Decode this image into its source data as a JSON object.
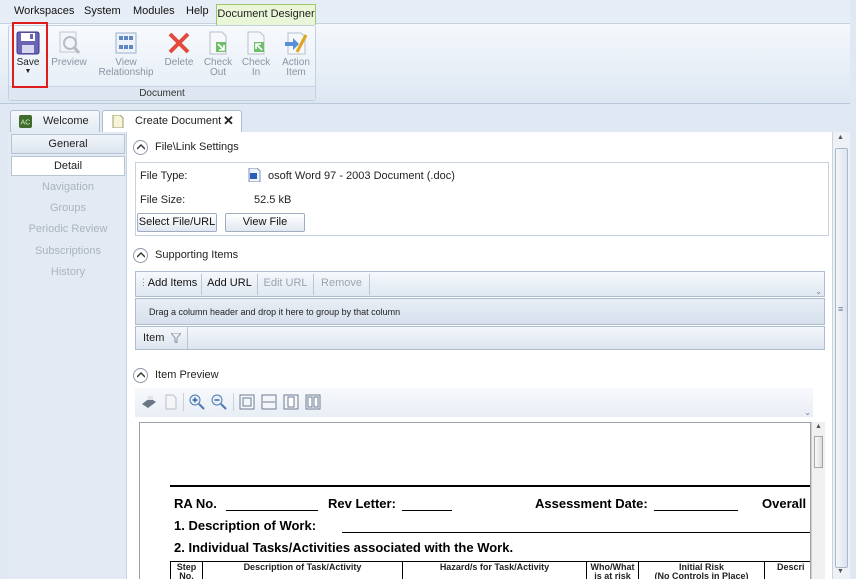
{
  "menubar": {
    "items": [
      "Workspaces",
      "System",
      "Modules",
      "Help"
    ],
    "active_tab": "Document Designer"
  },
  "ribbon": {
    "save_label": "Save",
    "preview_label": "Preview",
    "view_relationship_label": "View\nRelationship",
    "view_label_1": "View",
    "view_label_2": "Relationship",
    "delete_label": "Delete",
    "checkout_label_1": "Check",
    "checkout_label_2": "Out",
    "checkin_label_1": "Check",
    "checkin_label_2": "In",
    "action_label_1": "Action",
    "action_label_2": "Item",
    "group_label": "Document"
  },
  "tabs": [
    {
      "label": "Welcome"
    },
    {
      "label": "Create Document"
    }
  ],
  "nav": {
    "items": [
      "General",
      "Detail",
      "Navigation",
      "Groups",
      "Periodic Review",
      "Subscriptions",
      "History"
    ]
  },
  "file_settings": {
    "title": "File\\Link Settings",
    "file_type_label": "File Type:",
    "file_type_value": "osoft Word 97 - 2003 Document (.doc)",
    "file_size_label": "File Size:",
    "file_size_value": "52.5 kB",
    "select_button": "Select File/URL",
    "view_button": "View File"
  },
  "supporting": {
    "title": "Supporting Items",
    "add_items": "Add Items",
    "add_url": "Add URL",
    "edit_url": "Edit URL",
    "remove": "Remove",
    "group_hint": "Drag a column header and drop it here to group by that column",
    "column_item": "Item"
  },
  "preview": {
    "title": "Item Preview",
    "doc": {
      "ra_no": "RA No.",
      "rev_letter": "Rev Letter:",
      "assessment_date": "Assessment Date:",
      "overall": "Overall",
      "desc_work": "1. Description of Work:",
      "tasks": "2. Individual Tasks/Activities associated with the Work.",
      "col_step": "Step\nNo.",
      "col_step_1": "Step",
      "col_step_2": "No.",
      "col_desc": "Description of Task/Activity",
      "col_hazard": "Hazard/s for Task/Activity",
      "col_who_1": "Who/What",
      "col_who_2": "is at risk",
      "col_risk_1": "Initial Risk",
      "col_risk_2": "(No Controls in Place)",
      "col_descr": "Descri"
    }
  },
  "colors": {
    "highlight": "#e01b1b",
    "active_tab_bg": "#eaf6d8",
    "active_tab_border": "#9dc76d"
  }
}
